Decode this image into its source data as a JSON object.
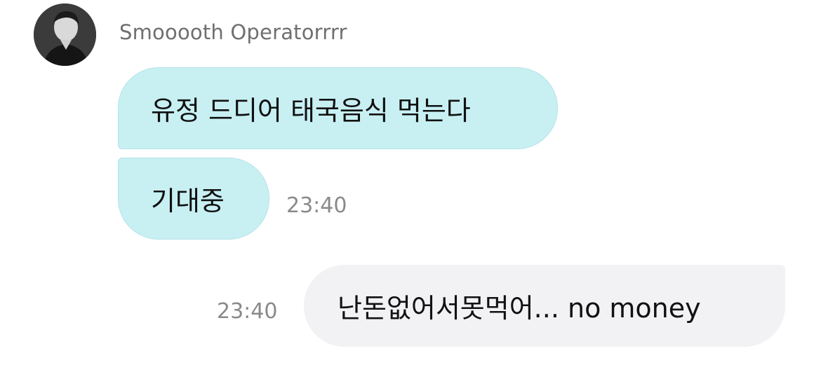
{
  "chat": {
    "sender": {
      "name": "Smooooth Operatorrrr",
      "avatar_icon": "profile-photo-avatar"
    },
    "messages": [
      {
        "direction": "incoming",
        "text": "유정 드디어 태국음식 먹는다",
        "time": ""
      },
      {
        "direction": "incoming",
        "text": "기대중",
        "time": "23:40"
      },
      {
        "direction": "outgoing",
        "text": "난돈없어서못먹어... no money",
        "time": "23:40"
      }
    ],
    "colors": {
      "incoming_bubble": "#c8f0f3",
      "outgoing_bubble": "#f2f2f5",
      "timestamp": "#8a8a8a",
      "sender_name": "#6f6f6f"
    }
  }
}
